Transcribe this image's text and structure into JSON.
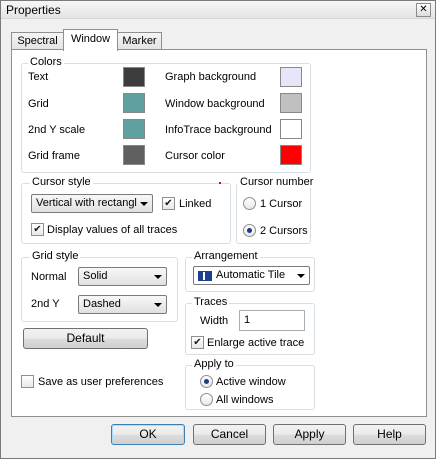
{
  "window": {
    "title": "Properties",
    "close_glyph": "✕"
  },
  "tabs": [
    {
      "label": "Spectral"
    },
    {
      "label": "Window"
    },
    {
      "label": "Marker"
    }
  ],
  "colors": {
    "group_label": "Colors",
    "items": [
      {
        "label": "Text",
        "color": "#3c3c3c"
      },
      {
        "label": "Grid",
        "color": "#60a0a0"
      },
      {
        "label": "2nd Y scale",
        "color": "#60a0a0"
      },
      {
        "label": "Grid frame",
        "color": "#606060"
      },
      {
        "label": "Graph background",
        "color": "#e6e6fa"
      },
      {
        "label": "Window background",
        "color": "#c0c0c0"
      },
      {
        "label": "InfoTrace background",
        "color": "#ffffff"
      },
      {
        "label": "Cursor color",
        "color": "#ff0000"
      }
    ]
  },
  "cursor_style": {
    "group_label": "Cursor style",
    "dropdown_value": "Vertical with rectangl",
    "linked_label": "Linked",
    "linked_checked": true,
    "display_all_label": "Display values of all traces",
    "display_all_checked": true
  },
  "cursor_number": {
    "group_label": "Cursor number",
    "options": [
      {
        "label": "1 Cursor",
        "selected": false
      },
      {
        "label": "2 Cursors",
        "selected": true
      }
    ]
  },
  "grid_style": {
    "group_label": "Grid style",
    "normal_label": "Normal",
    "normal_value": "Solid",
    "second_y_label": "2nd Y",
    "second_y_value": "Dashed"
  },
  "arrangement": {
    "group_label": "Arrangement",
    "value": "Automatic Tile"
  },
  "traces": {
    "group_label": "Traces",
    "width_label": "Width",
    "width_value": "1",
    "enlarge_label": "Enlarge active trace",
    "enlarge_checked": true
  },
  "default_button": "Default",
  "save_prefs": {
    "label": "Save as user preferences",
    "checked": false
  },
  "apply_to": {
    "group_label": "Apply to",
    "options": [
      {
        "label": "Active window",
        "selected": true
      },
      {
        "label": "All windows",
        "selected": false
      }
    ]
  },
  "footer": {
    "ok": "OK",
    "cancel": "Cancel",
    "apply": "Apply",
    "help": "Help"
  }
}
